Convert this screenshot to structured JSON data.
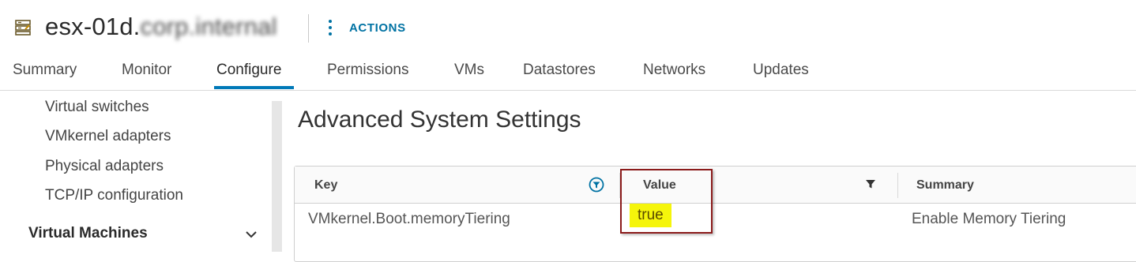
{
  "header": {
    "host_name_visible": "esx-01d.",
    "host_name_obscured": "corp.internal",
    "actions_label": "ACTIONS"
  },
  "tabs": [
    {
      "label": "Summary",
      "active": false
    },
    {
      "label": "Monitor",
      "active": false
    },
    {
      "label": "Configure",
      "active": true
    },
    {
      "label": "Permissions",
      "active": false
    },
    {
      "label": "VMs",
      "active": false
    },
    {
      "label": "Datastores",
      "active": false
    },
    {
      "label": "Networks",
      "active": false
    },
    {
      "label": "Updates",
      "active": false
    }
  ],
  "sidebar": {
    "items": [
      {
        "label": "Virtual switches"
      },
      {
        "label": "VMkernel adapters"
      },
      {
        "label": "Physical adapters"
      },
      {
        "label": "TCP/IP configuration"
      }
    ],
    "section": {
      "label": "Virtual Machines",
      "expanded": false
    }
  },
  "main": {
    "title": "Advanced System Settings",
    "grid": {
      "columns": [
        {
          "label": "Key",
          "filter_active": true
        },
        {
          "label": "Value",
          "filter_active": false
        },
        {
          "label": "Summary"
        }
      ],
      "rows": [
        {
          "key": "VMkernel.Boot.memoryTiering",
          "value": "true",
          "summary": "Enable Memory Tiering"
        }
      ]
    }
  },
  "colors": {
    "accent": "#0079b8",
    "link": "#0072a3",
    "highlight": "#f5f50b",
    "annotation_box": "#8b1b1b"
  },
  "icons": {
    "host": "host-server-icon",
    "actions": "vertical-ellipsis-icon",
    "filter_active": "filter-circle-icon",
    "filter": "filter-icon",
    "collapse": "chevron-down-icon"
  }
}
